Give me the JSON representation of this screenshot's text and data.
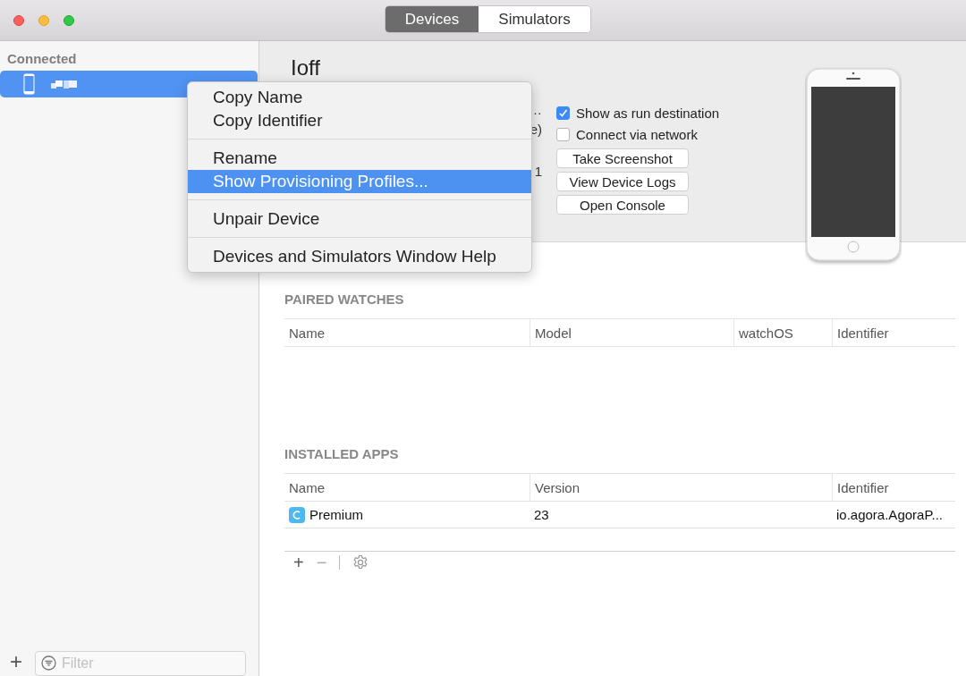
{
  "window": {
    "tabs": [
      {
        "label": "Devices",
        "selected": true
      },
      {
        "label": "Simulators",
        "selected": false
      }
    ]
  },
  "sidebar": {
    "section": "Connected",
    "devices": [
      {
        "selected": true
      }
    ],
    "add": "+",
    "filter": {
      "placeholder": "Filter"
    }
  },
  "device": {
    "name": "Ioff",
    "hidden_lines": [
      "…",
      "e)",
      "1"
    ],
    "options": [
      {
        "label": "Show as run destination",
        "checked": true
      },
      {
        "label": "Connect via network",
        "checked": false
      }
    ],
    "buttons": [
      "Take Screenshot",
      "View Device Logs",
      "Open Console"
    ]
  },
  "paired_watches": {
    "title": "PAIRED WATCHES",
    "columns": [
      "Name",
      "Model",
      "watchOS",
      "Identifier"
    ]
  },
  "installed_apps": {
    "title": "INSTALLED APPS",
    "columns": [
      "Name",
      "Version",
      "Identifier"
    ],
    "rows": [
      {
        "name": "Premium",
        "version": "23",
        "identifier": "io.agora.AgoraP..."
      }
    ],
    "toolbar": [
      "+",
      "−"
    ]
  },
  "context_menu": {
    "groups": [
      [
        {
          "label": "Copy Name",
          "selected": false
        },
        {
          "label": "Copy Identifier",
          "selected": false
        }
      ],
      [
        {
          "label": "Rename",
          "selected": false
        },
        {
          "label": "Show Provisioning Profiles...",
          "selected": true
        }
      ],
      [
        {
          "label": "Unpair Device",
          "selected": false
        }
      ],
      [
        {
          "label": "Devices and Simulators Window Help",
          "selected": false
        }
      ]
    ]
  }
}
